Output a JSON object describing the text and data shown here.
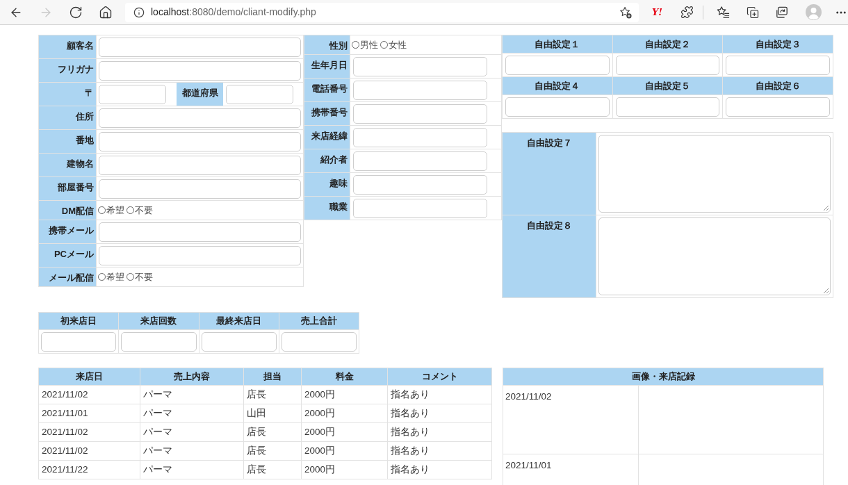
{
  "browser": {
    "nav": [
      {
        "kind": "back",
        "disabled": false
      },
      {
        "kind": "forward",
        "disabled": true
      },
      {
        "kind": "reload",
        "disabled": false
      },
      {
        "kind": "home",
        "disabled": false
      }
    ],
    "url": {
      "host": "localhost",
      "path": ":8080/demo/cliant-modify.php"
    },
    "extension_label": "Y!"
  },
  "customer_form": {
    "rows": [
      {
        "kind": "input",
        "label": "顧客名"
      },
      {
        "kind": "input",
        "label": "フリガナ"
      },
      {
        "kind": "postal",
        "label": "〒",
        "second_label": "都道府県"
      },
      {
        "kind": "input",
        "label": "住所"
      },
      {
        "kind": "input",
        "label": "番地"
      },
      {
        "kind": "input",
        "label": "建物名"
      },
      {
        "kind": "input",
        "label": "部屋番号"
      },
      {
        "kind": "radio",
        "label": "DM配信",
        "options": [
          {
            "label": "希望",
            "selected": false
          },
          {
            "label": "不要",
            "selected": false
          }
        ]
      },
      {
        "kind": "input",
        "label": "携帯メール"
      },
      {
        "kind": "input",
        "label": "PCメール"
      },
      {
        "kind": "radio",
        "label": "メール配信",
        "options": [
          {
            "label": "希望",
            "selected": false
          },
          {
            "label": "不要",
            "selected": false
          }
        ]
      }
    ]
  },
  "profile_form": {
    "rows": [
      {
        "kind": "radio",
        "label": "性別",
        "options": [
          {
            "label": "男性",
            "selected": false
          },
          {
            "label": "女性",
            "selected": false
          }
        ]
      },
      {
        "kind": "input",
        "label": "生年月日"
      },
      {
        "kind": "input",
        "label": "電話番号"
      },
      {
        "kind": "input",
        "label": "携帯番号"
      },
      {
        "kind": "input",
        "label": "来店経緯"
      },
      {
        "kind": "input",
        "label": "紹介者"
      },
      {
        "kind": "input",
        "label": "趣味"
      },
      {
        "kind": "input",
        "label": "職業"
      }
    ]
  },
  "custom_fields": [
    {
      "label": "自由設定１"
    },
    {
      "label": "自由設定２"
    },
    {
      "label": "自由設定３"
    },
    {
      "label": "自由設定４"
    },
    {
      "label": "自由設定５"
    },
    {
      "label": "自由設定６"
    }
  ],
  "custom_notes": [
    {
      "label": "自由設定７"
    },
    {
      "label": "自由設定８"
    }
  ],
  "visit_summary": {
    "columns": [
      "初来店日",
      "来店回数",
      "最終来店日",
      "売上合計"
    ]
  },
  "sales_history": {
    "columns": [
      "来店日",
      "売上内容",
      "担当",
      "料金",
      "コメント"
    ],
    "rows": [
      [
        "2021/11/02",
        "パーマ",
        "店長",
        "2000円",
        "指名あり"
      ],
      [
        "2021/11/01",
        "パーマ",
        "山田",
        "2000円",
        "指名あり"
      ],
      [
        "2021/11/02",
        "パーマ",
        "店長",
        "2000円",
        "指名あり"
      ],
      [
        "2021/11/02",
        "パーマ",
        "店長",
        "2000円",
        "指名あり"
      ],
      [
        "2021/11/22",
        "パーマ",
        "店長",
        "2000円",
        "指名あり"
      ]
    ]
  },
  "image_records": {
    "title": "画像・来店記録",
    "rows": [
      {
        "date": "2021/11/02"
      },
      {
        "date": "2021/11/01"
      }
    ]
  }
}
